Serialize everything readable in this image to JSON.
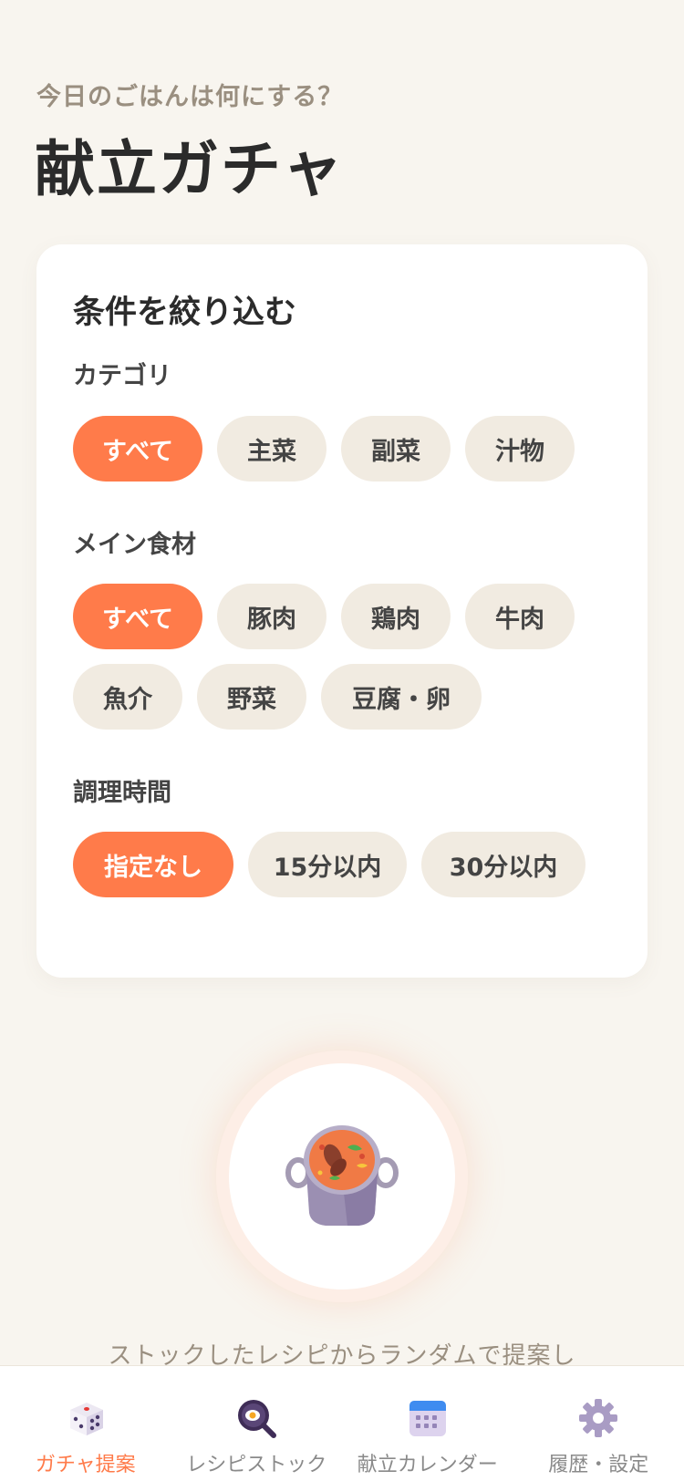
{
  "header": {
    "subtitle": "今日のごはんは何にする？",
    "title": "献立ガチャ"
  },
  "filters": {
    "title": "条件を絞り込む",
    "category": {
      "label": "カテゴリ",
      "options": [
        "すべて",
        "主菜",
        "副菜",
        "汁物"
      ],
      "selected": "すべて"
    },
    "main_ingredient": {
      "label": "メイン食材",
      "options": [
        "すべて",
        "豚肉",
        "鶏肉",
        "牛肉",
        "魚介",
        "野菜",
        "豆腐・卵"
      ],
      "selected": "すべて"
    },
    "cooking_time": {
      "label": "調理時間",
      "options": [
        "指定なし",
        "15分以内",
        "30分以内"
      ],
      "selected": "指定なし"
    }
  },
  "gacha": {
    "icon": "stew-pot-icon",
    "caption": "ストックしたレシピからランダムで提案し"
  },
  "tabbar": {
    "items": [
      {
        "label": "ガチャ提案",
        "icon": "dice-icon",
        "active": true
      },
      {
        "label": "レシピストック",
        "icon": "frying-pan-icon",
        "active": false
      },
      {
        "label": "献立カレンダー",
        "icon": "calendar-icon",
        "active": false
      },
      {
        "label": "履歴・設定",
        "icon": "gear-icon",
        "active": false
      }
    ]
  },
  "colors": {
    "accent": "#ff7b4a",
    "background": "#f8f5ef",
    "chip": "#f1ebe1",
    "muted_text": "#9a8f80"
  }
}
